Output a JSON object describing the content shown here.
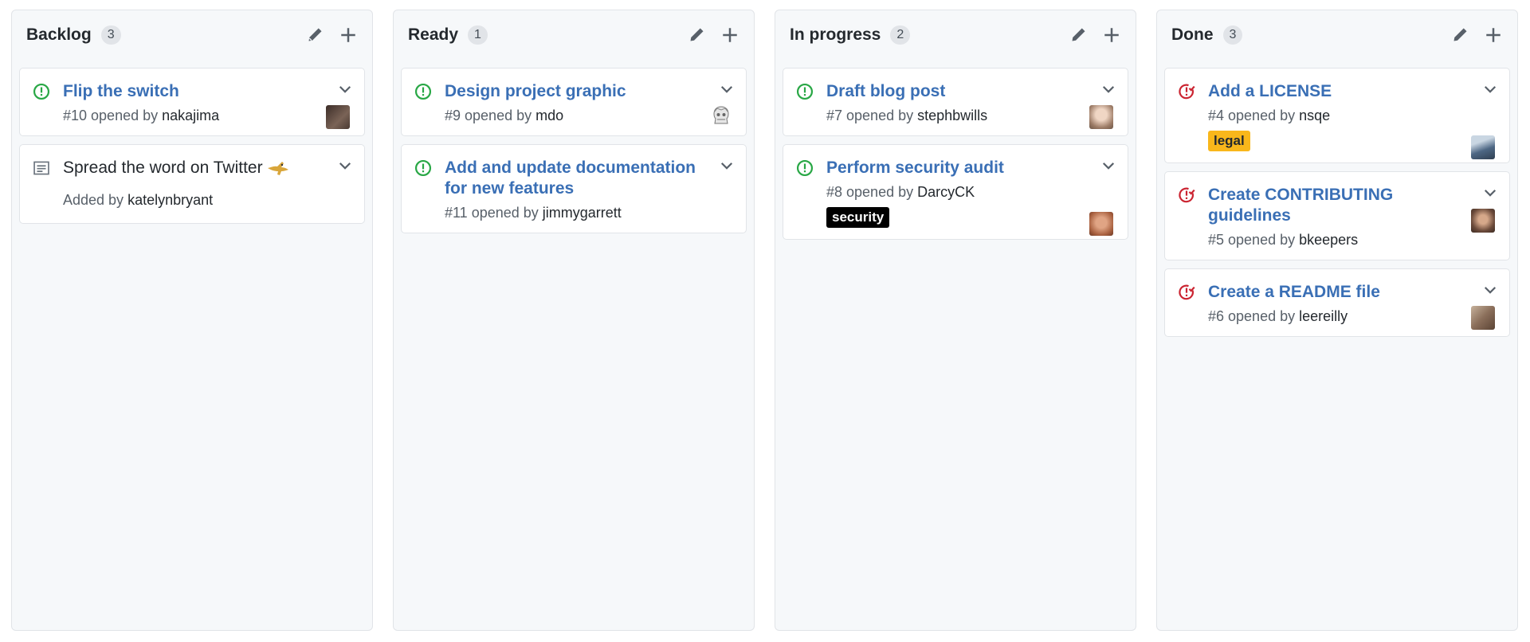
{
  "columns": [
    {
      "title": "Backlog",
      "count": "3",
      "cards": [
        {
          "kind": "issue",
          "title": "Flip the switch",
          "meta": "#10 opened by",
          "user": "nakajima",
          "avatar": "#5a4a42"
        },
        {
          "kind": "note",
          "title": "Spread the word on Twitter",
          "meta": "Added by",
          "user": "katelynbryant"
        }
      ]
    },
    {
      "title": "Ready",
      "count": "1",
      "cards": [
        {
          "kind": "issue",
          "title": "Design project graphic",
          "meta": "#9 opened by",
          "user": "mdo",
          "avatar": "#d8d8d8"
        },
        {
          "kind": "issue",
          "title": "Add and update documentation for new features",
          "meta": "#11 opened by",
          "user": "jimmygarrett"
        }
      ]
    },
    {
      "title": "In progress",
      "count": "2",
      "cards": [
        {
          "kind": "issue",
          "title": "Draft blog post",
          "meta": "#7 opened by",
          "user": "stephbwills",
          "avatar": "#c9a48b"
        },
        {
          "kind": "issue",
          "title": "Perform security audit",
          "meta": "#8 opened by",
          "user": "DarcyCK",
          "label": "security",
          "avatar": "#b06a4a"
        }
      ]
    },
    {
      "title": "Done",
      "count": "3",
      "cards": [
        {
          "kind": "closed",
          "title": "Add a LICENSE",
          "meta": "#4 opened by",
          "user": "nsqe",
          "label": "legal",
          "avatar": "#5d7a96"
        },
        {
          "kind": "closed",
          "title": "Create CONTRIBUTING guidelines",
          "meta": "#5 opened by",
          "user": "bkeepers",
          "avatar": "#6b4a3a"
        },
        {
          "kind": "closed",
          "title": "Create a README file",
          "meta": "#6 opened by",
          "user": "leereilly",
          "avatar": "#8a6e5a"
        }
      ]
    }
  ],
  "icons": {
    "column_edit": "pencil-icon",
    "column_add": "plus-icon",
    "issue_open": "issue-opened-icon",
    "issue_closed": "issue-closed-icon",
    "note": "note-icon",
    "menu": "chevron-down-icon"
  },
  "colors": {
    "open": "#28a745",
    "closed": "#cb2431",
    "link": "#3a6fb5",
    "label_security": "#000000",
    "label_legal": "#f9b71b"
  }
}
